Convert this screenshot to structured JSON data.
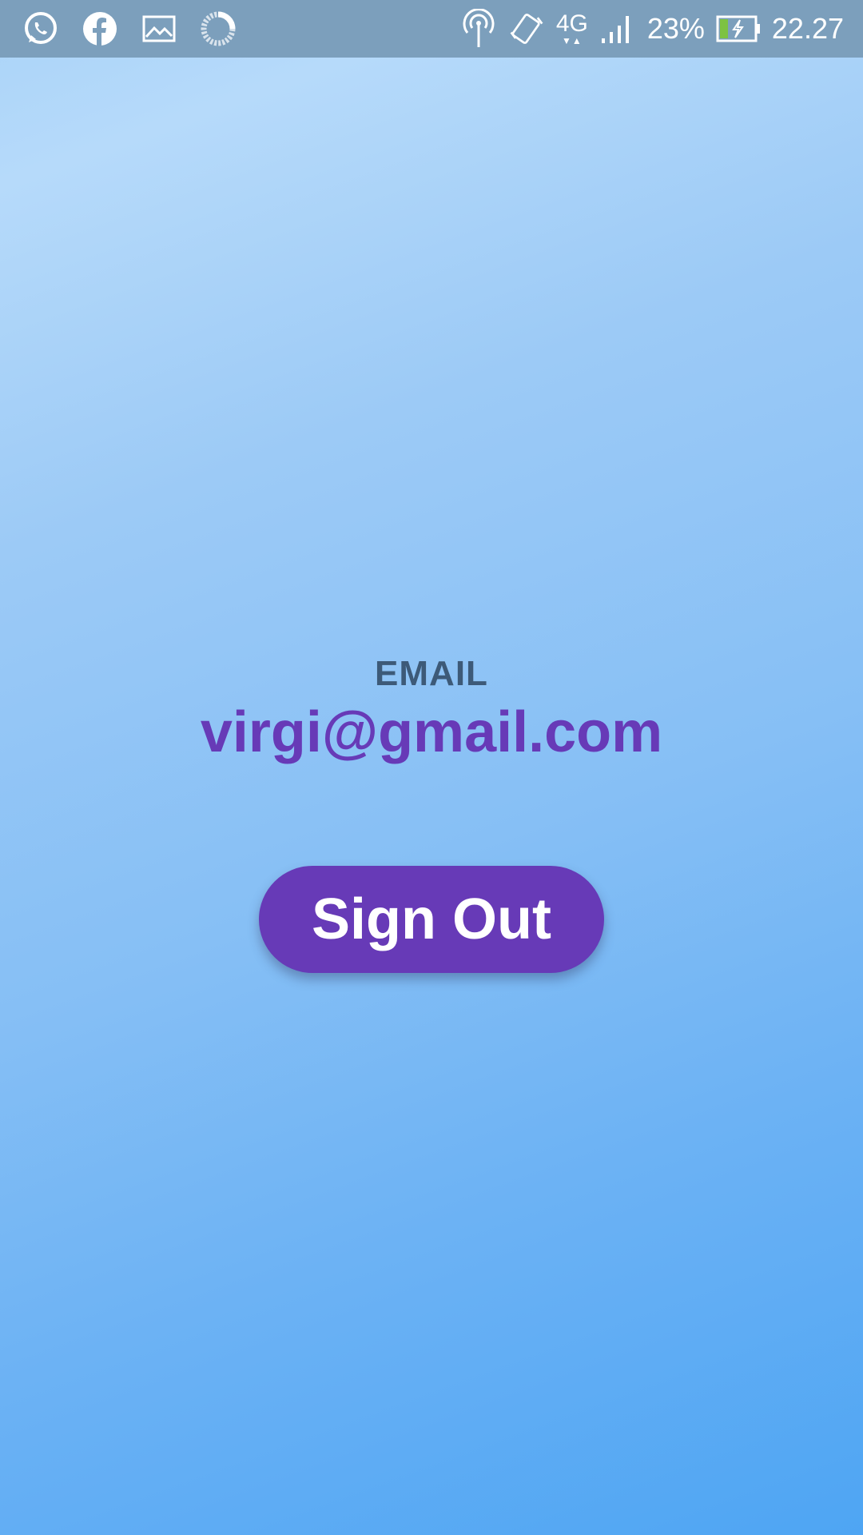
{
  "status_bar": {
    "left_icons": [
      "whatsapp-icon",
      "facebook-icon",
      "gallery-icon",
      "loading-icon"
    ],
    "right_icons": [
      "hotspot-icon",
      "rotate-icon"
    ],
    "network_type": "4G",
    "battery_percent_text": "23%",
    "time": "22.27",
    "battery_level": 0.23
  },
  "main": {
    "email_label": "EMAIL",
    "email_value": "virgi@gmail.com",
    "signout_label": "Sign Out"
  },
  "colors": {
    "accent": "#673ab7",
    "label": "#3d5a78",
    "status_bar": "#7c9fbc"
  }
}
